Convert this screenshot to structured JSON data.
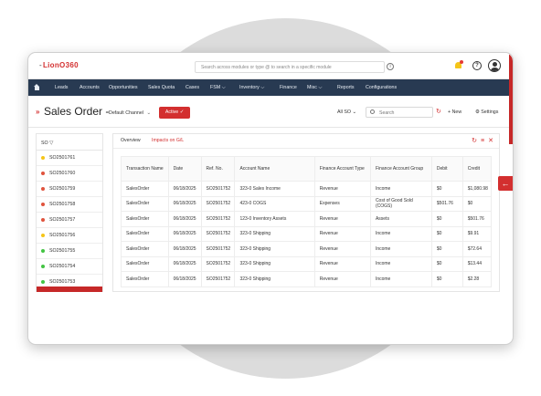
{
  "app": {
    "logo_text": "LionO360",
    "logo_mark": "‑"
  },
  "topbar": {
    "search_placeholder": "Search across modules or type @ to search in a specific module",
    "info_icon": "i",
    "help_icon": "?"
  },
  "nav": {
    "items": [
      "Leads",
      "Accounts",
      "Opportunities",
      "Sales Quota",
      "Cases",
      "FSM ⌵",
      "Inventory ⌵",
      "Finance",
      "Misc ⌵",
      "Reports",
      "Configurations"
    ]
  },
  "header": {
    "title": "Sales Order",
    "dash": "-",
    "channel": "Default Channel",
    "channel_caret": "⌄",
    "status_label": "Active ✓",
    "view_label": "All SO ⌄",
    "search_placeholder": "Search",
    "new_label": "+ New",
    "settings_label": "⚙ Settings"
  },
  "left_panel": {
    "header": "SO ▽",
    "items": [
      {
        "id": "SO2501761",
        "dot": "#f5c518"
      },
      {
        "id": "SO2501760",
        "dot": "#e0533d"
      },
      {
        "id": "SO2501759",
        "dot": "#e0533d"
      },
      {
        "id": "SO2501758",
        "dot": "#e0533d"
      },
      {
        "id": "SO2501757",
        "dot": "#e0533d"
      },
      {
        "id": "SO2501756",
        "dot": "#f5c518"
      },
      {
        "id": "SO2501755",
        "dot": "#43c443"
      },
      {
        "id": "SO2501754",
        "dot": "#43c443"
      },
      {
        "id": "SO2501753",
        "dot": "#43c443"
      }
    ]
  },
  "right_panel": {
    "tabs": [
      "Overview",
      "Impacts on G/L"
    ],
    "active_tab": 1,
    "icons": [
      "↻",
      "≡",
      "✕"
    ],
    "columns": [
      "Transaction Name",
      "Date",
      "Ref. No.",
      "Account Name",
      "Finance Account Type",
      "Finance Account Group",
      "Debit",
      "Credit"
    ],
    "rows": [
      [
        "SalesOrder",
        "06/18/2025",
        "SO2501752",
        "323-0 Sales Income",
        "Revenue",
        "Income",
        "$0",
        "$1,080.98"
      ],
      [
        "SalesOrder",
        "06/18/2025",
        "SO2501752",
        "423-0 COGS",
        "Expenses",
        "Cost of Good Sold (COGS)",
        "$501.76",
        "$0"
      ],
      [
        "SalesOrder",
        "06/18/2025",
        "SO2501752",
        "123-0 Inventory Assets",
        "Revenue",
        "Assets",
        "$0",
        "$501.76"
      ],
      [
        "SalesOrder",
        "06/18/2025",
        "SO2501752",
        "323-0 Shipping",
        "Revenue",
        "Income",
        "$0",
        "$9.91"
      ],
      [
        "SalesOrder",
        "06/18/2025",
        "SO2501752",
        "323-0 Shipping",
        "Revenue",
        "Income",
        "$0",
        "$72.64"
      ],
      [
        "SalesOrder",
        "06/18/2025",
        "SO2501752",
        "323-0 Shipping",
        "Revenue",
        "Income",
        "$0",
        "$13.44"
      ],
      [
        "SalesOrder",
        "06/18/2025",
        "SO2501752",
        "323-0 Shipping",
        "Revenue",
        "Income",
        "$0",
        "$2.28"
      ]
    ]
  },
  "collapse_icon": "←",
  "colors": {
    "accent": "#d32f2f",
    "nav_bg": "#283a52"
  }
}
